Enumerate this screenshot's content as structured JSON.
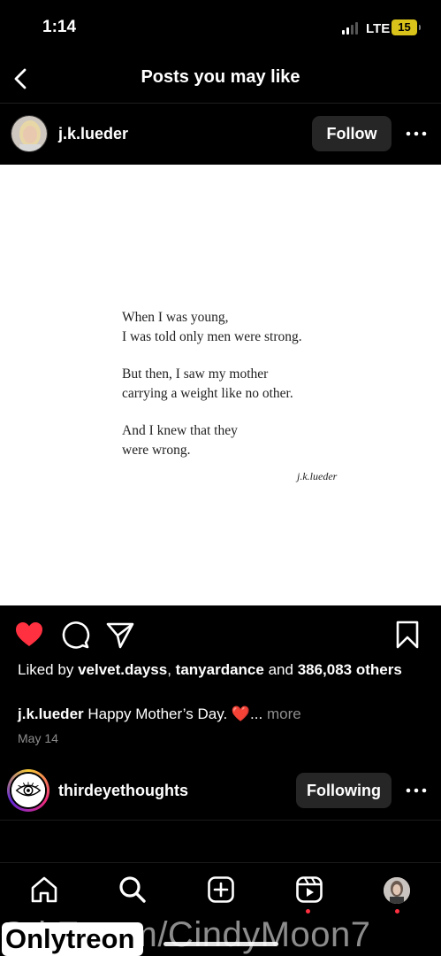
{
  "status_bar": {
    "time": "1:14",
    "network": "LTE",
    "battery": "15"
  },
  "header": {
    "title": "Posts you may like"
  },
  "post": {
    "username": "j.k.lueder",
    "follow_label": "Follow",
    "poem": {
      "stanza1": [
        "When I was young,",
        "I was told only men were strong."
      ],
      "stanza2": [
        "But then, I saw my mother",
        "carrying a weight like no other."
      ],
      "stanza3": [
        "And I knew that they",
        "were wrong."
      ],
      "signature": "j.k.lueder"
    },
    "liked_by_prefix": "Liked by",
    "liked_by_user1": "velvet.dayss",
    "liked_by_sep": ",",
    "liked_by_user2": "tanyardance",
    "liked_by_and": "and",
    "liked_by_count": "386,083 others",
    "caption_user": "j.k.lueder",
    "caption_text": "Happy Mother’s Day. ❤️...",
    "caption_more": "more",
    "date": "May 14",
    "liked": true
  },
  "next_post": {
    "username": "thirdeyethoughts",
    "following_label": "Following"
  },
  "bottom_nav": {
    "items": [
      "home",
      "search",
      "create",
      "reels",
      "profile"
    ]
  },
  "watermark": {
    "logo": "Onlytreon",
    "text": "O i F .c m/CindyMoon7"
  },
  "colors": {
    "like_red": "#ff3040",
    "button_bg": "#262626",
    "muted": "#8e8e8e"
  }
}
